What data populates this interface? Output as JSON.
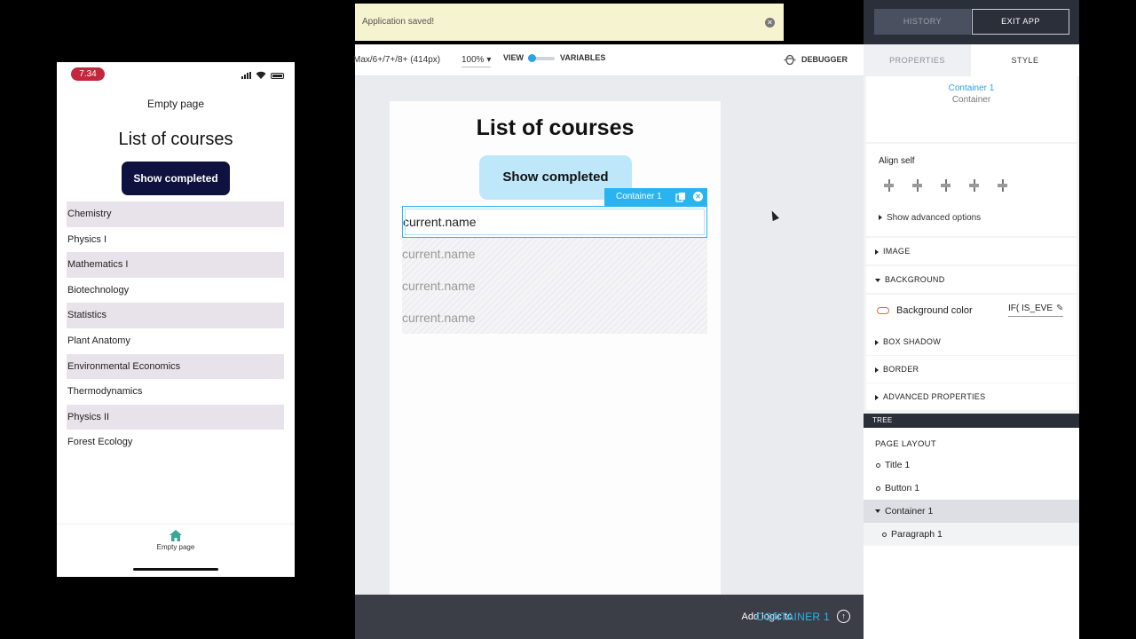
{
  "phone": {
    "time": "7.34",
    "header": "Empty page",
    "title": "List of courses",
    "button_label": "Show completed",
    "courses": [
      "Chemistry",
      "Physics I",
      "Mathematics I",
      "Biotechnology",
      "Statistics",
      "Plant Anatomy",
      "Environmental Economics",
      "Thermodynamics",
      "Physics II",
      "Forest Ecology"
    ],
    "tab_label": "Empty page",
    "accent_color": "#3aa890"
  },
  "toast": {
    "message": "Application saved!"
  },
  "topbar": {
    "history": "HISTORY",
    "exit": "EXIT APP"
  },
  "toolbar": {
    "device": "Max/6+/7+/8+ (414px)",
    "zoom": "100%",
    "view": "VIEW",
    "variables": "VARIABLES",
    "debugger": "DEBUGGER"
  },
  "canvas": {
    "title": "List of courses",
    "button_label": "Show completed",
    "badge": "Container 1",
    "items": [
      "current.name",
      "current.name",
      "current.name",
      "current.name"
    ]
  },
  "bottom": {
    "add_logic": "Add logic to",
    "target": "CONTAINER 1"
  },
  "panel": {
    "tabs": [
      "PROPERTIES",
      "STYLE"
    ],
    "selected_name": "Container 1",
    "selected_type": "Container",
    "align_self": "Align self",
    "advanced_options": "Show advanced options",
    "sections": [
      "IMAGE",
      "BACKGROUND",
      "BOX SHADOW",
      "BORDER",
      "ADVANCED PROPERTIES"
    ],
    "background_color_label": "Background color",
    "background_formula": "IF( IS_EVE"
  },
  "tree": {
    "header": "TREE",
    "root": "PAGE LAYOUT",
    "items": [
      "Title 1",
      "Button 1",
      "Container 1",
      "Paragraph 1"
    ]
  }
}
